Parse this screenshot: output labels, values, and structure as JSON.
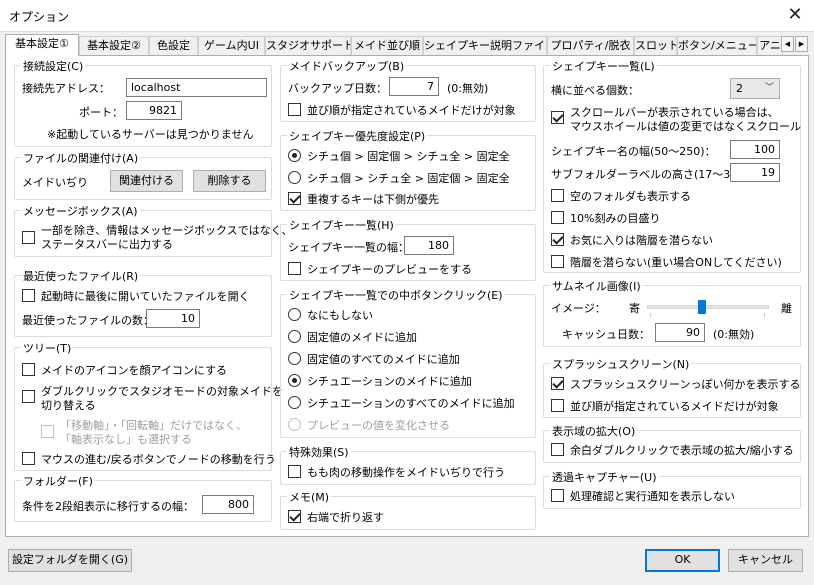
{
  "window": {
    "title": "オプション",
    "close_glyph": "✕"
  },
  "tabs": [
    "基本設定①",
    "基本設定②",
    "色設定",
    "ゲーム内UI",
    "スタジオサポート",
    "メイド並び順",
    "シェイプキー説明ファイル",
    "プロパティ/脱衣",
    "スロット",
    "ボタン/メニュー",
    "アニ"
  ],
  "tab_scroll": {
    "left": "◀",
    "right": "▶"
  },
  "connection": {
    "title": "接続設定(C)",
    "address_label": "接続先アドレス：",
    "address": "localhost",
    "port_label": "ポート：",
    "port": "9821",
    "note": "※起動しているサーバーは見つかりません"
  },
  "file_assoc": {
    "title": "ファイルの関連付け(A)",
    "label": "メイドいぢり",
    "assoc_button": "関連付ける",
    "delete_button": "削除する"
  },
  "msgbox": {
    "title": "メッセージボックス(A)",
    "option": "一部を除き、情報はメッセージボックスではなく、ステータスバーに出力する",
    "option_l1": "一部を除き、情報はメッセージボックスではなく、",
    "option_l2": "ステータスバーに出力する"
  },
  "recent": {
    "title": "最近使ったファイル(R)",
    "open_last": "起動時に最後に開いていたファイルを開く",
    "count_label": "最近使ったファイルの数：",
    "count": "10"
  },
  "tree": {
    "title": "ツリー(T)",
    "face_icon": "メイドのアイコンを顔アイコンにする",
    "dbl_l1": "ダブルクリックでスタジオモードの対象メイドを",
    "dbl_l2": "切り替える",
    "sub_l1": "「移動軸」・「回転軸」だけではなく、",
    "sub_l2": "「軸表示なし」も選択する",
    "mouse_nav": "マウスの進む/戻るボタンでノードの移動を行う"
  },
  "folder": {
    "title": "フォルダー(F)",
    "label": "条件を2段組表示に移行するの幅：",
    "value": "800"
  },
  "backup": {
    "title": "メイドバックアップ(B)",
    "days_label": "バックアップ日数：",
    "days": "7",
    "days_note": "(0:無効)",
    "sorted_only": "並び順が指定されているメイドだけが対象"
  },
  "priority": {
    "title": "シェイプキー優先度設定(P)",
    "opt1": "シチュ個 > 固定個 > シチュ全 > 固定全",
    "opt2": "シチュ個 > シチュ全 > 固定個 > 固定全",
    "dup_lower": "重複するキーは下側が優先"
  },
  "shapelist_mid": {
    "title": "シェイプキー一覧(H)",
    "width_label": "シェイプキー一覧の幅：",
    "width": "180",
    "preview": "シェイプキーのプレビューをする"
  },
  "middle_click": {
    "title": "シェイプキー一覧での中ボタンクリック(E)",
    "o1": "なにもしない",
    "o2": "固定値のメイドに追加",
    "o3": "固定値のすべてのメイドに追加",
    "o4": "シチュエーションのメイドに追加",
    "o5": "シチュエーションのすべてのメイドに追加",
    "o6": "プレビューの値を変化させる"
  },
  "effects": {
    "title": "特殊効果(S)",
    "peach": "もも肉の移動操作をメイドいぢりで行う"
  },
  "memo": {
    "title": "メモ(M)",
    "wrap": "右端で折り返す"
  },
  "shapelist_right": {
    "title": "シェイプキー一覧(L)",
    "cols_label": "横に並べる個数：",
    "cols": "2",
    "arrow": "﹀",
    "scroll_l1": "スクロールバーが表示されている場合は、",
    "scroll_l2": "マウスホイールは値の変更ではなくスクロール",
    "name_w_label": "シェイプキー名の幅(50〜250)：",
    "name_w": "100",
    "sub_h_label": "サブフォルダーラベルの高さ(17〜35)：",
    "sub_h": "19",
    "empty_folder": "空のフォルダも表示する",
    "ten_percent": "10%刻みの目盛り",
    "fav_noexpand": "お気に入りは階層を潜らない",
    "noexpand": "階層を潜らない(重い場合ONしてください)"
  },
  "thumbnail": {
    "title": "サムネイル画像(I)",
    "image_label": "イメージ：",
    "near": "寄",
    "far": "離",
    "slider_value": 0.45,
    "cache_label": "キャッシュ日数：",
    "cache": "90",
    "cache_note": "(0:無効)"
  },
  "splash": {
    "title": "スプラッシュスクリーン(N)",
    "show": "スプラッシュスクリーンっぽい何かを表示する",
    "sorted_only": "並び順が指定されているメイドだけが対象"
  },
  "display_zoom": {
    "title": "表示域の拡大(O)",
    "dbl": "余白ダブルクリックで表示域の拡大/縮小する"
  },
  "capture": {
    "title": "透過キャプチャー(U)",
    "no_notify": "処理確認と実行通知を表示しない"
  },
  "footer": {
    "open_folder": "設定フォルダを開く(G)",
    "ok": "OK",
    "cancel": "キャンセル"
  }
}
